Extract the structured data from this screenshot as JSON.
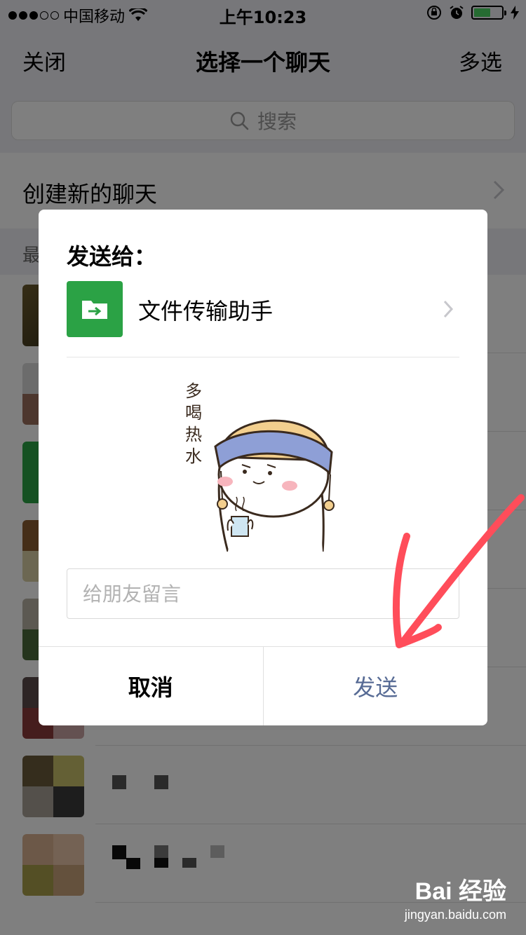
{
  "status_bar": {
    "carrier": "中国移动",
    "time": "上午10:23"
  },
  "nav": {
    "left": "关闭",
    "title": "选择一个聊天",
    "right": "多选"
  },
  "search": {
    "placeholder": "搜索"
  },
  "new_chat": {
    "label": "创建新的聊天"
  },
  "recent_header": {
    "label": "最"
  },
  "dialog": {
    "title": "发送给：",
    "recipient_name": "文件传输助手",
    "sticker_text": "多喝热水",
    "input_placeholder": "给朋友留言",
    "cancel_label": "取消",
    "send_label": "发送"
  },
  "watermark": {
    "logo": "Bai 经验",
    "url": "jingyan.baidu.com"
  },
  "colors": {
    "wechat_green": "#2ba245",
    "send_blue": "#576b95",
    "annotation_red": "#ff4d5a"
  }
}
